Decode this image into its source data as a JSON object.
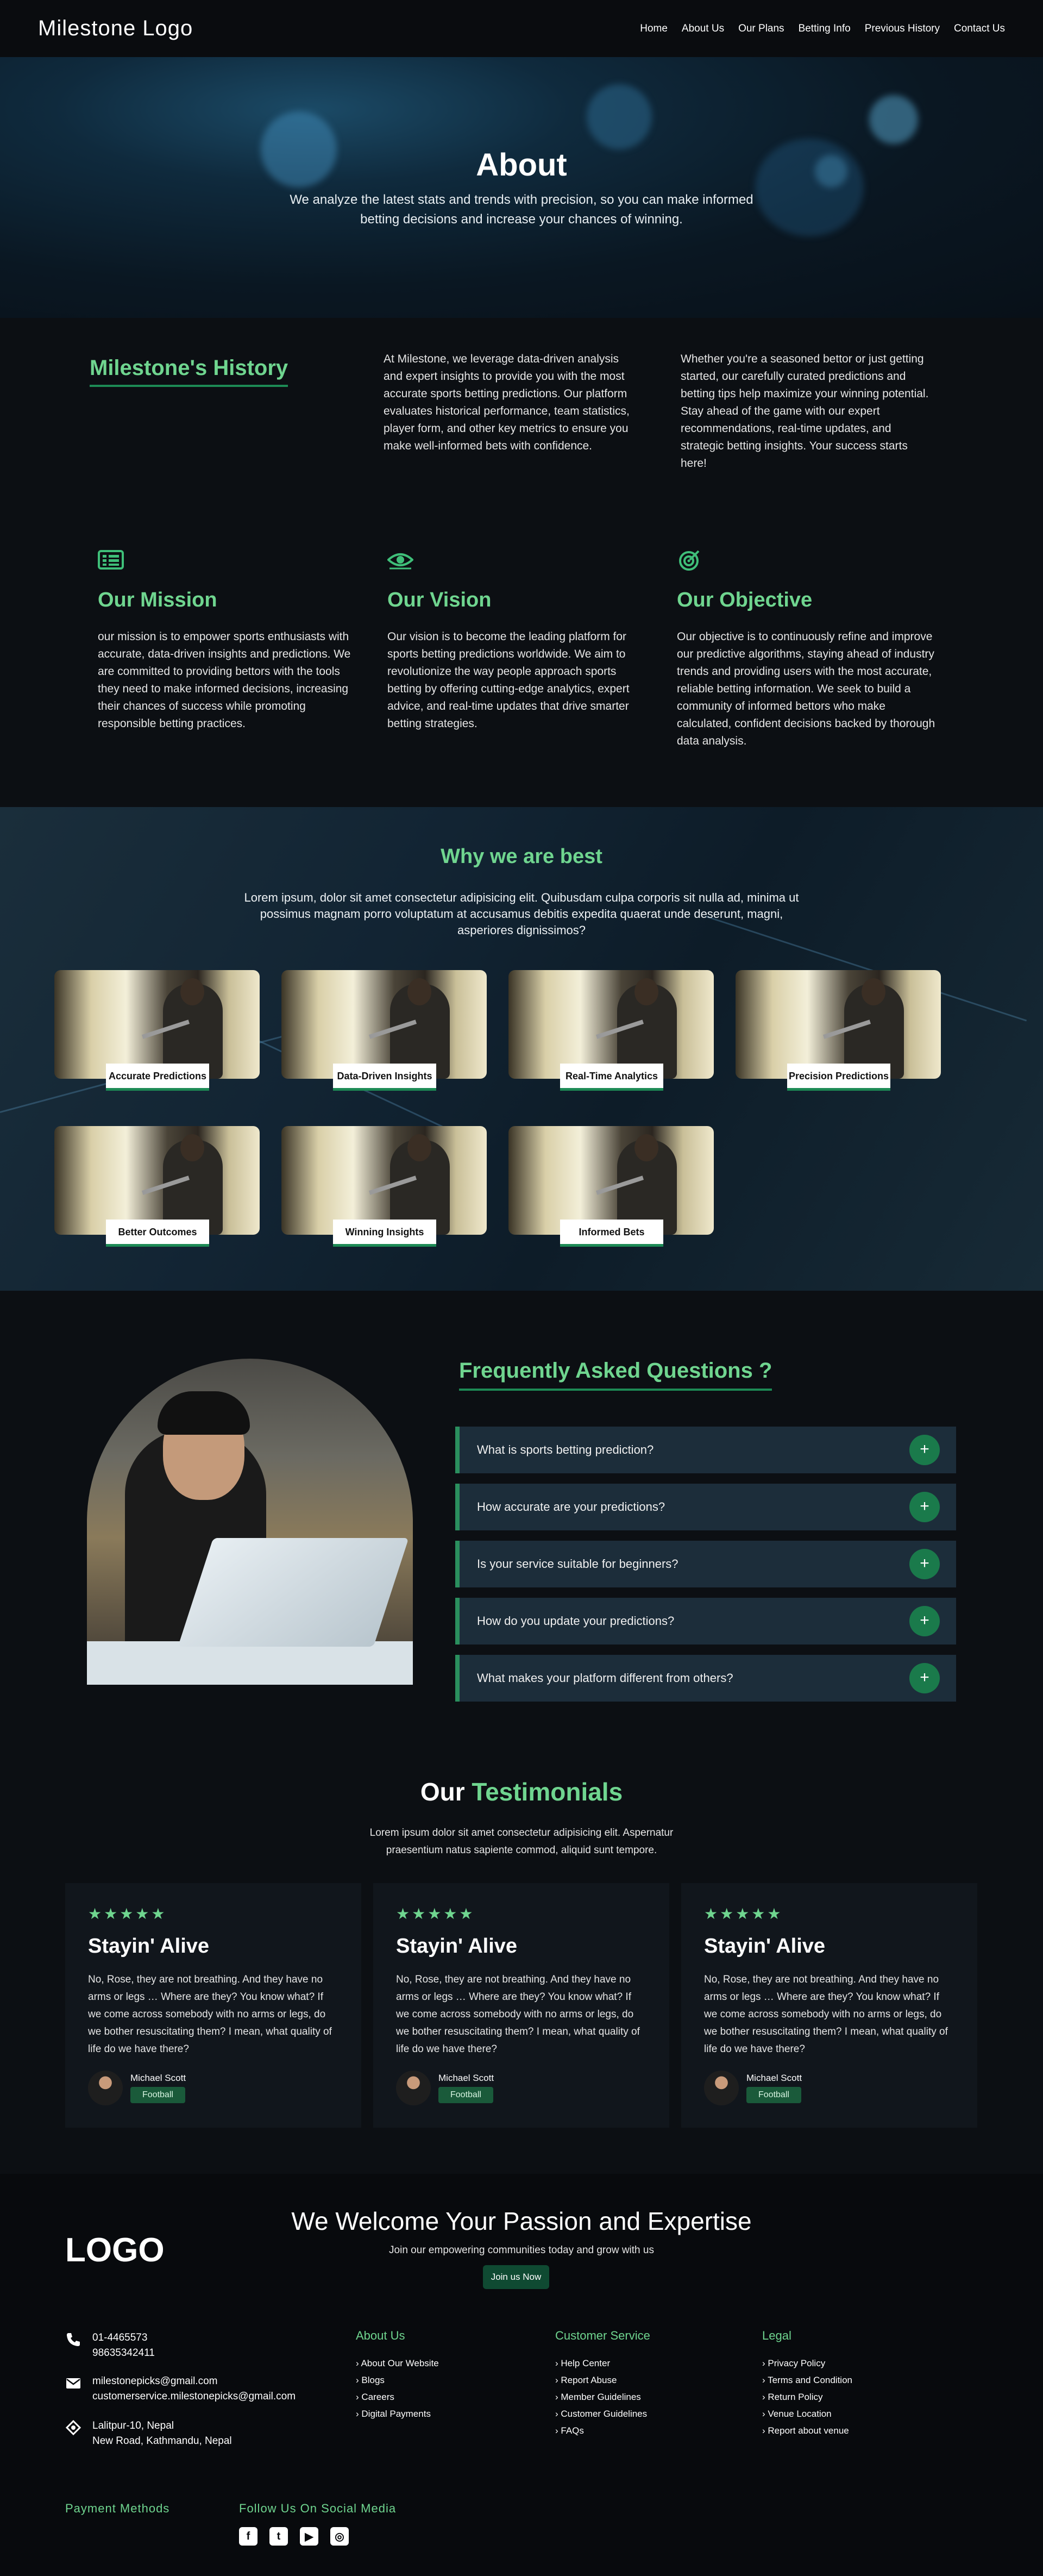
{
  "nav": {
    "logo": "Milestone Logo",
    "links": [
      "Home",
      "About Us",
      "Our Plans",
      "Betting Info",
      "Previous History",
      "Contact Us"
    ]
  },
  "hero": {
    "title": "About",
    "subtitle": "We analyze the latest stats and trends with precision, so you can make informed betting decisions and increase your chances of winning."
  },
  "history": {
    "title": "Milestone's History",
    "para1": "At Milestone, we leverage data-driven analysis and expert insights to provide you with the most accurate sports betting predictions. Our platform evaluates historical performance, team statistics, player form, and other key metrics to ensure you make well-informed bets with confidence.",
    "para2": "Whether you're a seasoned bettor or just getting started, our carefully curated predictions and betting tips help maximize your winning potential. Stay ahead of the game with our expert recommendations, real-time updates, and strategic betting insights. Your success starts here!"
  },
  "pillars": [
    {
      "icon": "list-icon",
      "title": "Our Mission",
      "text": "our mission is to empower sports enthusiasts with accurate, data-driven insights and predictions. We are committed to providing bettors with the tools they need to make informed decisions, increasing their chances of success while promoting responsible betting practices."
    },
    {
      "icon": "eye-icon",
      "title": "Our Vision",
      "text": "Our vision is to become the leading platform for sports betting predictions worldwide. We aim to revolutionize the way people approach sports betting by offering cutting-edge analytics, expert advice, and real-time updates that drive smarter betting strategies."
    },
    {
      "icon": "target-icon",
      "title": "Our Objective",
      "text": "Our objective is to continuously refine and improve our predictive algorithms, staying ahead of industry trends and providing users with the most accurate, reliable betting information. We seek to build a community of informed bettors who make calculated, confident decisions backed by thorough data analysis."
    }
  ],
  "why": {
    "title": "Why we are best",
    "text": "Lorem ipsum, dolor sit amet consectetur adipisicing elit. Quibusdam culpa corporis sit nulla ad, minima ut possimus magnam porro voluptatum at accusamus debitis expedita quaerat unde deserunt, magni, asperiores dignissimos?",
    "cards": [
      "Accurate Predictions",
      "Data-Driven Insights",
      "Real-Time Analytics",
      "Precision Predictions",
      "Better Outcomes",
      "Winning Insights",
      "Informed Bets"
    ]
  },
  "faq": {
    "title": "Frequently Asked Questions ?",
    "questions": [
      "What is sports betting prediction?",
      "How accurate are your predictions?",
      "Is your service suitable for beginners?",
      "How do you update your predictions?",
      "What makes your platform different from others?"
    ],
    "plus": "+"
  },
  "testimonials": {
    "title_plain": "Our",
    "title_accent": "Testimonials",
    "intro": "Lorem ipsum dolor sit amet consectetur adipisicing elit. Aspernatur praesentium natus sapiente commod, aliquid sunt tempore.",
    "items": [
      {
        "stars": "★★★★★",
        "title": "Stayin' Alive",
        "text": "No, Rose, they are not breathing. And they have no arms or legs … Where are they? You know what? If we come across somebody with no arms or legs, do we bother resuscitating them? I mean, what quality of life do we have there?",
        "name": "Michael Scott",
        "tag": "Football"
      },
      {
        "stars": "★★★★★",
        "title": "Stayin' Alive",
        "text": "No, Rose, they are not breathing. And they have no arms or legs … Where are they? You know what? If we come across somebody with no arms or legs, do we bother resuscitating them? I mean, what quality of life do we have there?",
        "name": "Michael Scott",
        "tag": "Football"
      },
      {
        "stars": "★★★★★",
        "title": "Stayin' Alive",
        "text": "No, Rose, they are not breathing. And they have no arms or legs … Where are they? You know what? If we come across somebody with no arms or legs, do we bother resuscitating them? I mean, what quality of life do we have there?",
        "name": "Michael Scott",
        "tag": "Football"
      }
    ]
  },
  "footer": {
    "logo": "LOGO",
    "welcome": "We Welcome Your Passion and Expertise",
    "join_text": "Join our empowering communities today and grow with us",
    "join_button": "Join us Now",
    "phones": [
      "01-4465573",
      "98635342411"
    ],
    "emails": [
      "milestonepicks@gmail.com",
      "customerservice.milestonepicks@gmail.com"
    ],
    "address": [
      "Lalitpur-10, Nepal",
      "New Road, Kathmandu, Nepal"
    ],
    "columns": [
      {
        "title": "About Us",
        "links": [
          "About Our Website",
          "Blogs",
          "Careers",
          "Digital Payments"
        ]
      },
      {
        "title": "Customer Service",
        "links": [
          "Help Center",
          "Report Abuse",
          "Member Guidelines",
          "Customer Guidelines",
          "FAQs"
        ]
      },
      {
        "title": "Legal",
        "links": [
          "Privacy Policy",
          "Terms and Condition",
          "Return Policy",
          "Venue Location",
          "Report about venue"
        ]
      }
    ],
    "payment_title": "Payment Methods",
    "social_title": "Follow Us On Social Media",
    "social_icons": [
      "facebook-icon",
      "twitter-icon",
      "youtube-icon",
      "instagram-icon"
    ]
  },
  "colors": {
    "accent": "#6fd58f",
    "accent_dark": "#1d8a55",
    "background": "#0c0f13"
  }
}
